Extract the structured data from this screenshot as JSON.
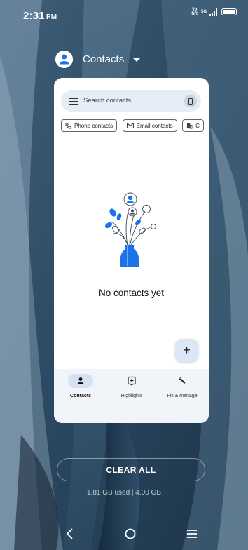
{
  "status_bar": {
    "time": "2:31",
    "ampm": "PM",
    "volte_top": "Vo",
    "volte_bottom": "NR",
    "network": "5G"
  },
  "recent_app": {
    "name": "Contacts",
    "icon": "contacts-app-icon"
  },
  "contacts": {
    "search_placeholder": "Search contacts",
    "chips": [
      "Phone contacts",
      "Email contacts",
      "C"
    ],
    "empty_message": "No contacts yet",
    "fab_label": "+",
    "nav": [
      {
        "label": "Contacts",
        "icon": "person-icon",
        "active": true
      },
      {
        "label": "Highlights",
        "icon": "highlights-icon",
        "active": false
      },
      {
        "label": "Fix & manage",
        "icon": "wrench-icon",
        "active": false
      }
    ]
  },
  "recents": {
    "clear_all": "CLEAR ALL",
    "memory": "1.81 GB used | 4.00 GB"
  },
  "colors": {
    "accent": "#1a73e8",
    "card_bg": "#ffffff",
    "search_bg": "#e6ecf6",
    "nav_bg": "#f1f4f9",
    "wallpaper": "#2c4a63"
  }
}
